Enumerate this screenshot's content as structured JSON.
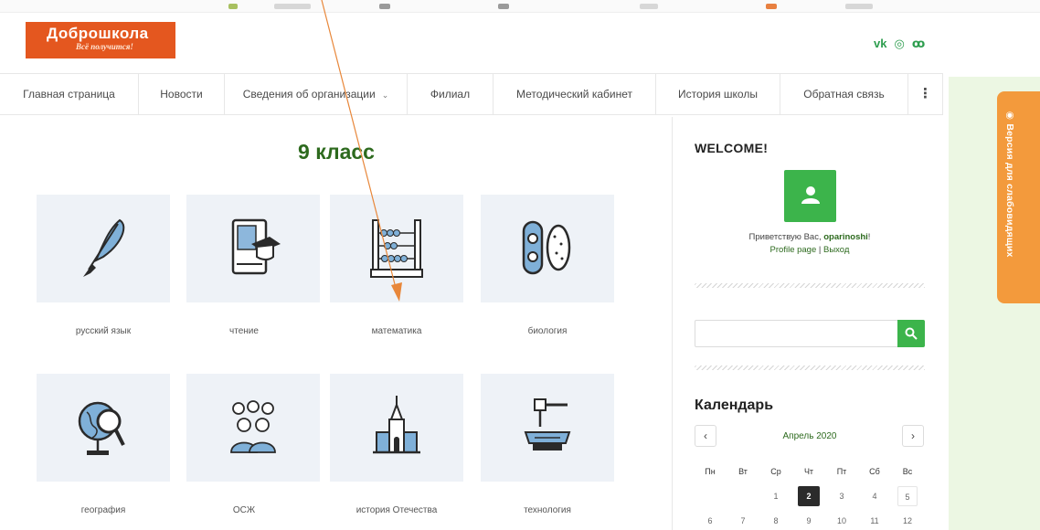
{
  "logo": {
    "name": "Доброшкола",
    "tagline": "Всё получится!"
  },
  "social_icons": [
    "vk-icon",
    "instagram-icon",
    "odnoklassniki-icon"
  ],
  "social_labels": [
    "vk",
    "◎",
    "ꝏ"
  ],
  "nav": {
    "items": [
      "Главная страница",
      "Новости",
      "Сведения об организации",
      "Филиал",
      "Методический кабинет",
      "История школы",
      "Обратная связь"
    ],
    "more_label": "⋮"
  },
  "main": {
    "title": "9 класс",
    "subjects": [
      {
        "label": "русский язык",
        "icon": "quill-pen-icon"
      },
      {
        "label": "чтение",
        "icon": "book-with-graduation-cap-icon"
      },
      {
        "label": "математика",
        "icon": "abacus-icon"
      },
      {
        "label": "биология",
        "icon": "cell-icon"
      },
      {
        "label": "география",
        "icon": "globe-magnifier-icon"
      },
      {
        "label": "ОСЖ",
        "icon": "people-group-icon"
      },
      {
        "label": "история Отечества",
        "icon": "cathedral-icon"
      },
      {
        "label": "технология",
        "icon": "hammer-anvil-icon"
      }
    ]
  },
  "sidebar": {
    "welcome": "WELCOME!",
    "greeting_prefix": "Приветствую Вас, ",
    "username": "oparinoshi",
    "greeting_suffix": "!",
    "profile_link": "Profile page",
    "separator": " | ",
    "logout_link": "Выход",
    "search_placeholder": "",
    "calendar": {
      "title": "Календарь",
      "month": "Апрель 2020",
      "prev": "‹",
      "next": "›",
      "weekdays": [
        "Пн",
        "Вт",
        "Ср",
        "Чт",
        "Пт",
        "Сб",
        "Вс"
      ],
      "row1": [
        "",
        "",
        "1",
        "2",
        "3",
        "4",
        "5"
      ],
      "row2": [
        "6",
        "7",
        "8",
        "9",
        "10",
        "11",
        "12"
      ],
      "today": "2"
    }
  },
  "accessibility": {
    "label": "◉ Версия для слабовидящих"
  },
  "colors": {
    "brand_orange": "#e4571f",
    "accent_green": "#3cb44b",
    "title_green": "#2d6a1e",
    "tab_orange": "#f39a3c",
    "annotation_arrow": "#e8873a"
  }
}
